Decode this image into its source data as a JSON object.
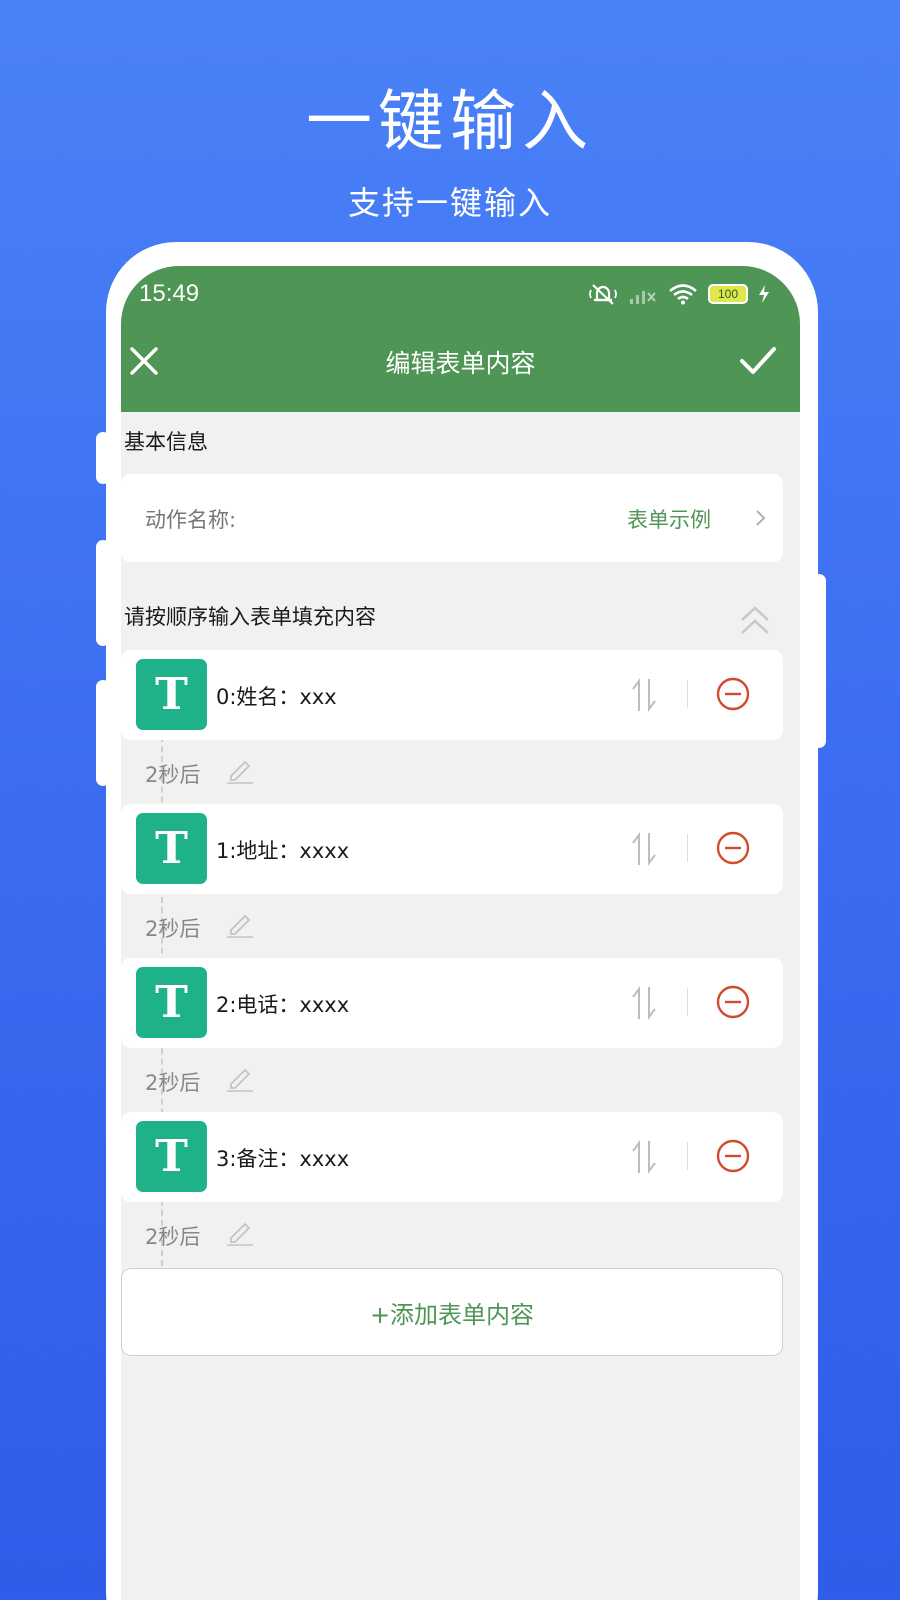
{
  "promo": {
    "title": "一键输入",
    "subtitle": "支持一键输入"
  },
  "status_bar": {
    "time": "15:49",
    "battery": "100"
  },
  "app_bar": {
    "title": "编辑表单内容",
    "close_icon": "close-icon",
    "confirm_icon": "check-icon"
  },
  "basic_info": {
    "section_title": "基本信息",
    "action_name_label": "动作名称:",
    "action_name_value": "表单示例"
  },
  "form_section": {
    "title": "请按顺序输入表单填充内容",
    "items": [
      {
        "badge": "T",
        "text": "0:姓名：xxx",
        "delay": "2秒后"
      },
      {
        "badge": "T",
        "text": "1:地址：xxxx",
        "delay": "2秒后"
      },
      {
        "badge": "T",
        "text": "2:电话：xxxx",
        "delay": "2秒后"
      },
      {
        "badge": "T",
        "text": "3:备注：xxxx",
        "delay": "2秒后"
      }
    ],
    "add_button": "+添加表单内容"
  },
  "colors": {
    "background": "#3d6ef2",
    "app_bar": "#4e9556",
    "badge": "#1fb28a",
    "remove": "#d14a2f"
  }
}
